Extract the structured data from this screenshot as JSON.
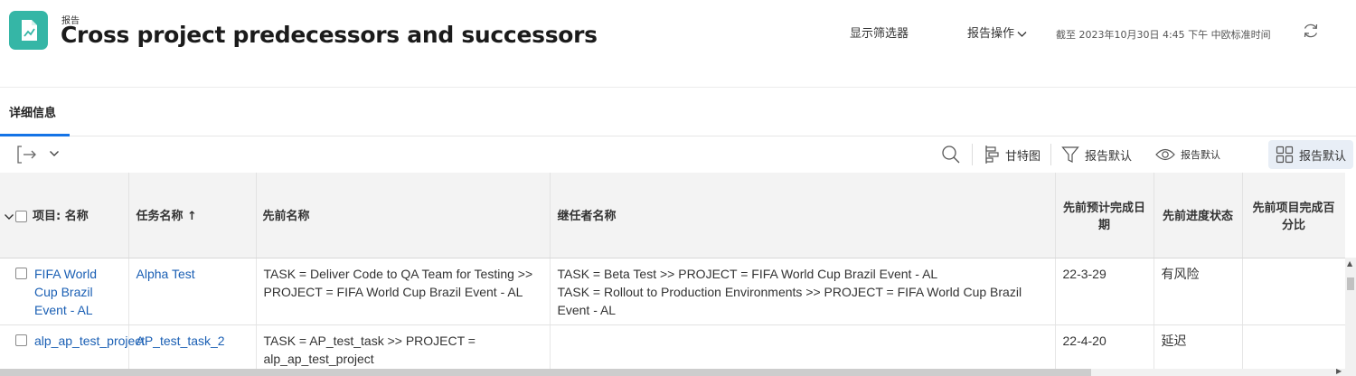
{
  "header": {
    "eyebrow": "报告",
    "title": "Cross project predecessors and successors",
    "show_filter": "显示筛选器",
    "report_actions": "报告操作",
    "as_of": "截至 2023年10月30日 4:45 下午 中欧标准时间"
  },
  "tabs": [
    {
      "label": "详细信息",
      "active": true
    }
  ],
  "toolbar": {
    "gantt": "甘特图",
    "filter": "报告默认",
    "view": "报告默认",
    "group": "报告默认"
  },
  "table": {
    "columns": [
      "项目: 名称",
      "任务名称 ↑",
      "先前名称",
      "继任者名称",
      "先前预计完成日期",
      "先前进度状态",
      "先前项目完成百分比"
    ],
    "rows": [
      {
        "project": "FIFA World Cup Brazil Event - AL",
        "task": "Alpha Test",
        "predecessor": "TASK = Deliver Code to QA Team for Testing >> PROJECT = FIFA World Cup Brazil Event - AL",
        "successor_1": "TASK = Beta Test >> PROJECT = FIFA World Cup Brazil Event - AL",
        "successor_2": "TASK = Rollout to Production Environments >> PROJECT = FIFA World Cup Brazil Event - AL",
        "date": "22-3-29",
        "status": "有风险",
        "percent": ""
      },
      {
        "project": "alp_ap_test_project",
        "task": "AP_test_task_2",
        "predecessor": "TASK = AP_test_task >> PROJECT = alp_ap_test_project",
        "successor_1": "",
        "successor_2": "",
        "date": "22-4-20",
        "status": "延迟",
        "percent": ""
      }
    ]
  },
  "colors": {
    "brand": "#35b6a6",
    "link": "#1a5fb4",
    "tab_accent": "#1473e6"
  },
  "icons": [
    "report-icon",
    "chevron-down-icon",
    "refresh-icon",
    "export-icon",
    "search-icon",
    "gantt-icon",
    "filter-icon",
    "eye-icon",
    "grid-icon"
  ]
}
